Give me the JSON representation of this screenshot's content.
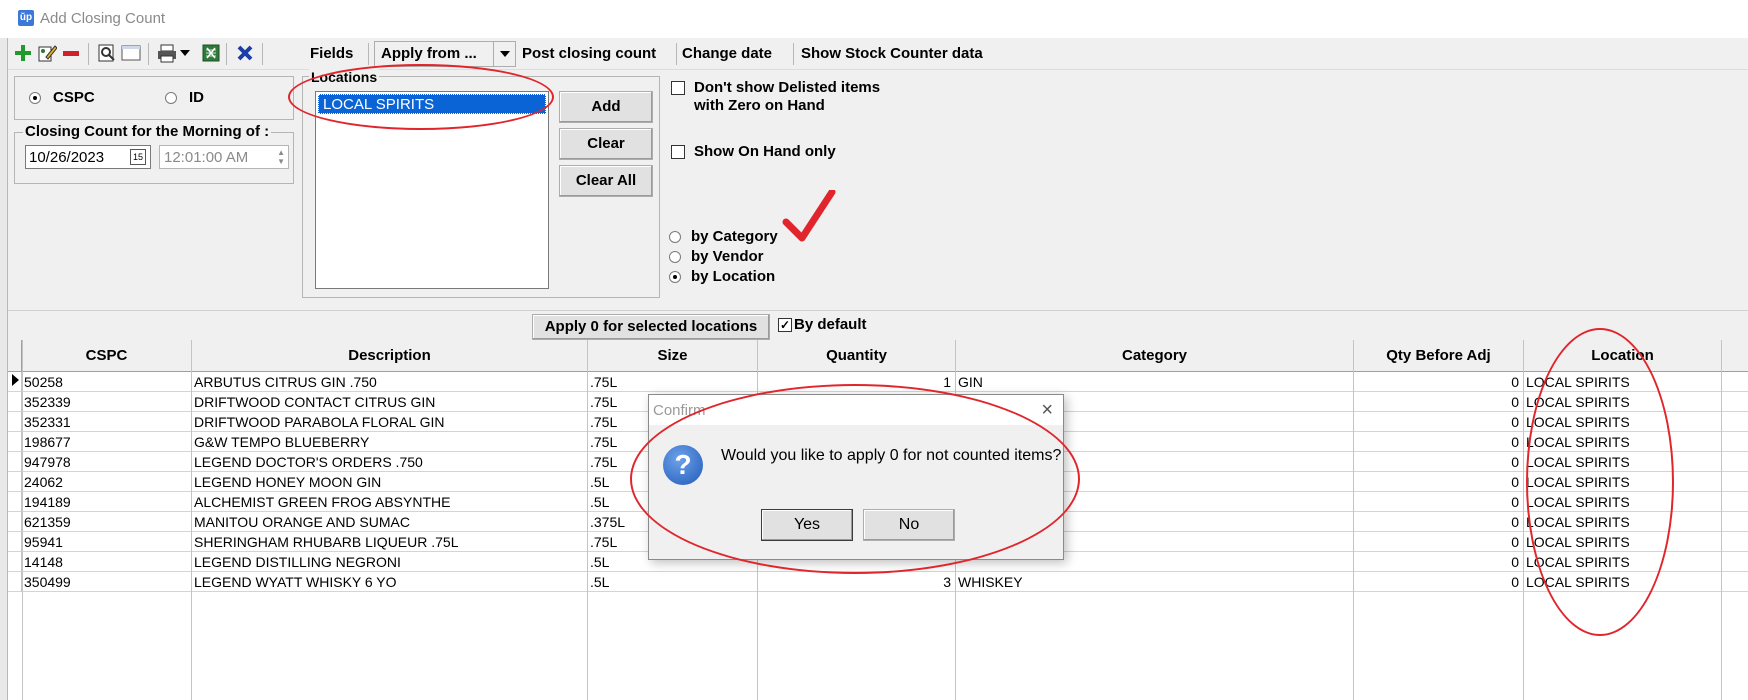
{
  "window": {
    "title": "Add Closing Count",
    "icon_text": "ŭp"
  },
  "toolbar": {
    "icons": [
      "add-icon",
      "edit-icon",
      "remove-icon",
      "preview-icon",
      "blank-icon",
      "print-icon",
      "dropdown-icon",
      "spreadsheet-icon",
      "delete-icon"
    ],
    "fields_label": "Fields",
    "apply_from_label": "Apply from ...",
    "post_closing_label": "Post closing count",
    "change_date_label": "Change date",
    "stock_counter_label": "Show Stock Counter data"
  },
  "id_mode": {
    "options": [
      "CSPC",
      "ID"
    ],
    "selected": "CSPC"
  },
  "closing_count": {
    "title": "Closing Count for the Morning of :",
    "date": "10/26/2023",
    "time": "12:01:00 AM"
  },
  "locations": {
    "title": "Locations",
    "items": [
      "LOCAL SPIRITS"
    ],
    "selected": "LOCAL SPIRITS",
    "add_label": "Add",
    "clear_label": "Clear",
    "clear_all_label": "Clear All"
  },
  "filters": {
    "delisted_label_line1": "Don't show Delisted items",
    "delisted_label_line2": "with Zero on Hand",
    "delisted_checked": false,
    "onhand_label": "Show On Hand only",
    "onhand_checked": false
  },
  "grouping": {
    "options": [
      "by Category",
      "by Vendor",
      "by Location"
    ],
    "selected": "by Location"
  },
  "apply0": {
    "button_label": "Apply 0 for selected locations",
    "by_default_label": "By default",
    "by_default_checked": true
  },
  "grid": {
    "columns": [
      "CSPC",
      "Description",
      "Size",
      "Quantity",
      "Category",
      "Qty Before Adj",
      "Location"
    ],
    "rows": [
      {
        "cspc": "50258",
        "description": "ARBUTUS CITRUS GIN .750",
        "size": ".75L",
        "quantity": "1",
        "category": "GIN",
        "qty_before": "0",
        "location": "LOCAL SPIRITS"
      },
      {
        "cspc": "352339",
        "description": "DRIFTWOOD CONTACT CITRUS GIN",
        "size": ".75L",
        "quantity": "",
        "category": "",
        "qty_before": "0",
        "location": "LOCAL SPIRITS"
      },
      {
        "cspc": "352331",
        "description": "DRIFTWOOD PARABOLA FLORAL GIN",
        "size": ".75L",
        "quantity": "",
        "category": "",
        "qty_before": "0",
        "location": "LOCAL SPIRITS"
      },
      {
        "cspc": "198677",
        "description": "G&W TEMPO BLUEBERRY",
        "size": ".75L",
        "quantity": "",
        "category": "",
        "qty_before": "0",
        "location": "LOCAL SPIRITS"
      },
      {
        "cspc": "947978",
        "description": "LEGEND DOCTOR'S ORDERS .750",
        "size": ".75L",
        "quantity": "",
        "category": "",
        "qty_before": "0",
        "location": "LOCAL SPIRITS"
      },
      {
        "cspc": "24062",
        "description": "LEGEND HONEY MOON GIN",
        "size": ".5L",
        "quantity": "",
        "category": "",
        "qty_before": "0",
        "location": "LOCAL SPIRITS"
      },
      {
        "cspc": "194189",
        "description": "ALCHEMIST GREEN FROG ABSYNTHE",
        "size": ".5L",
        "quantity": "",
        "category": "",
        "qty_before": "0",
        "location": "LOCAL SPIRITS"
      },
      {
        "cspc": "621359",
        "description": "MANITOU ORANGE AND SUMAC",
        "size": ".375L",
        "quantity": "",
        "category": "",
        "qty_before": "0",
        "location": "LOCAL SPIRITS"
      },
      {
        "cspc": "95941",
        "description": "SHERINGHAM RHUBARB LIQUEUR .75L",
        "size": ".75L",
        "quantity": "",
        "category": "",
        "qty_before": "0",
        "location": "LOCAL SPIRITS"
      },
      {
        "cspc": "14148",
        "description": "LEGEND DISTILLING NEGRONI",
        "size": ".5L",
        "quantity": "",
        "category": "",
        "qty_before": "0",
        "location": "LOCAL SPIRITS"
      },
      {
        "cspc": "350499",
        "description": "LEGEND WYATT WHISKY 6 YO",
        "size": ".5L",
        "quantity": "3",
        "category": "WHISKEY",
        "qty_before": "0",
        "location": "LOCAL SPIRITS"
      }
    ]
  },
  "dialog": {
    "title": "Confirm",
    "close_glyph": "×",
    "icon_glyph": "?",
    "message": "Would you like to apply 0 for not counted items?",
    "yes_label": "Yes",
    "no_label": "No"
  },
  "annotation_color": "#e0262c"
}
